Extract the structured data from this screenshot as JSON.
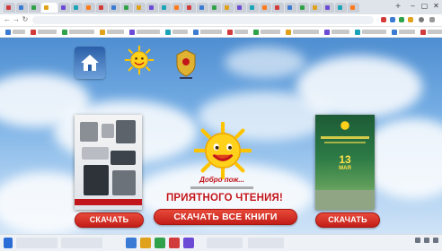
{
  "browser": {
    "url": "",
    "tab_count": 28
  },
  "page": {
    "buttons": {
      "download_left": "СКАЧАТЬ",
      "download_right": "СКАЧАТЬ",
      "download_all": "СКАЧАТЬ ВСЕ КНИГИ"
    },
    "slogan": {
      "greeting": "Добро пож...",
      "main": "ПРИЯТНОГО ЧТЕНИЯ!"
    },
    "book_right": {
      "date_number": "13",
      "date_month": "МАЯ"
    }
  },
  "icons": {
    "home": "home-icon",
    "sun_small": "sun-smile-icon",
    "emblem": "emblem-icon",
    "sun_big": "sun-smile-icon"
  },
  "colors": {
    "accent_red": "#c2141b",
    "sun_yellow": "#ffd11a",
    "sky_blue": "#5b9ad8"
  }
}
